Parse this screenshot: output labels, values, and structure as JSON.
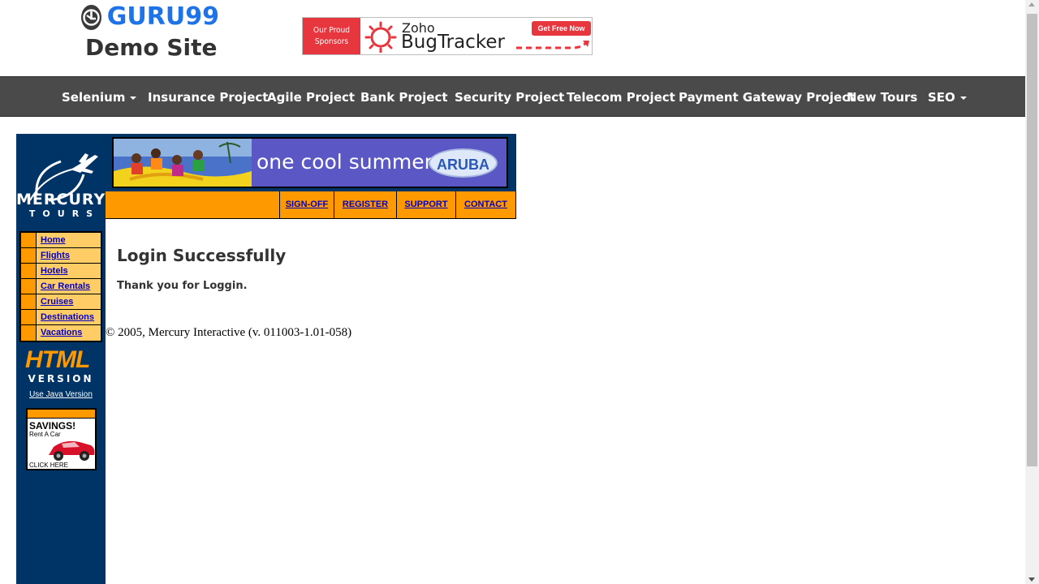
{
  "header": {
    "brand": "GURU99",
    "subtitle": "Demo Site",
    "sponsor": {
      "line1": "Our Proud",
      "line2": "Sponsors",
      "zoho": "Zoho",
      "product": "BugTracker",
      "cta": "Get Free Now"
    }
  },
  "nav": {
    "items": [
      {
        "label": "Selenium",
        "dropdown": true
      },
      {
        "label": "Insurance Project"
      },
      {
        "label": "Agile Project"
      },
      {
        "label": "Bank Project"
      },
      {
        "label": "Security Project"
      },
      {
        "label": "Telecom Project"
      },
      {
        "label": "Payment Gateway Project"
      },
      {
        "label": "New Tours"
      },
      {
        "label": "SEO",
        "dropdown": true
      }
    ]
  },
  "mercury": {
    "logo_line1": "MERCURY",
    "logo_line2": "TOURS",
    "side_menu": [
      "Home",
      "Flights",
      "Hotels",
      "Car Rentals",
      "Cruises",
      "Destinations",
      "Vacations"
    ],
    "html_version_big": "HTML",
    "html_version_small": "VERSION",
    "java_link": "Use Java Version",
    "savings_title": "SAVINGS!",
    "savings_sub": "Rent A Car",
    "savings_click": "CLICK HERE",
    "banner_text": "one cool summer",
    "banner_brand": "ARUBA",
    "top_menu": [
      "SIGN-OFF",
      "REGISTER",
      "SUPPORT",
      "CONTACT"
    ]
  },
  "main": {
    "title": "Login Successfully",
    "message": "Thank you for Loggin.",
    "copyright": "© 2005, Mercury Interactive (v. 011003-1.01-058)"
  },
  "colors": {
    "nav_bg": "#4a4a4a",
    "brand_blue": "#1e73e8",
    "mercury_navy": "#003366",
    "mercury_orange": "#ff9900",
    "menu_yellow": "#ffcc66",
    "link_blue": "#0000cc"
  }
}
